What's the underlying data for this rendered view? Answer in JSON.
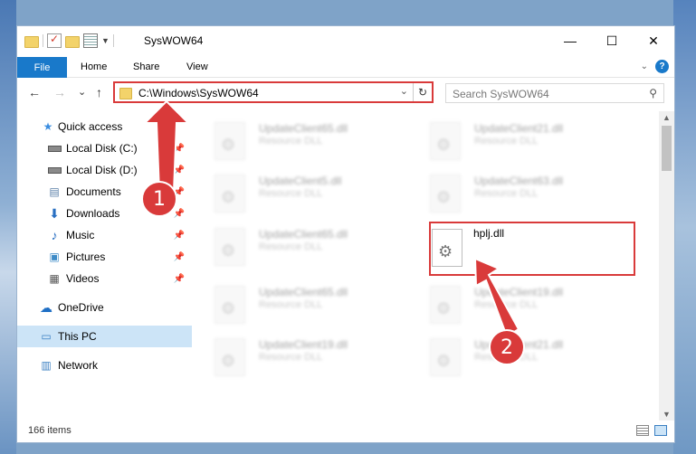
{
  "window": {
    "title": "SysWOW64",
    "minimize": "—",
    "maximize": "☐",
    "close": "✕"
  },
  "ribbon": {
    "tabs": [
      "File",
      "Home",
      "Share",
      "View"
    ]
  },
  "navigation": {
    "back": "←",
    "forward": "→",
    "recent": "⌄",
    "up": "↑"
  },
  "address_bar": {
    "path": "C:\\Windows\\SysWOW64"
  },
  "search": {
    "placeholder": "Search SysWOW64"
  },
  "sidebar": {
    "items": [
      {
        "label": "Quick access",
        "icon": "star-icon"
      },
      {
        "label": "Local Disk (C:)",
        "icon": "drive-icon",
        "pinned": true
      },
      {
        "label": "Local Disk (D:)",
        "icon": "drive-icon",
        "pinned": true
      },
      {
        "label": "Documents",
        "icon": "documents-icon",
        "pinned": true
      },
      {
        "label": "Downloads",
        "icon": "downloads-icon",
        "pinned": true
      },
      {
        "label": "Music",
        "icon": "music-icon",
        "pinned": true
      },
      {
        "label": "Pictures",
        "icon": "pictures-icon",
        "pinned": true
      },
      {
        "label": "Videos",
        "icon": "videos-icon",
        "pinned": true
      },
      {
        "label": "OneDrive",
        "icon": "cloud-icon"
      },
      {
        "label": "This PC",
        "icon": "computer-icon",
        "selected": true
      },
      {
        "label": "Network",
        "icon": "network-icon"
      }
    ]
  },
  "files": [
    {
      "name": "UpdateClient65.dll",
      "type": "Resource DLL",
      "blurred": true
    },
    {
      "name": "UpdateClient21.dll",
      "type": "Resource DLL",
      "blurred": true
    },
    {
      "name": "UpdateClient5.dll",
      "type": "Resource DLL",
      "blurred": true
    },
    {
      "name": "UpdateClient63.dll",
      "type": "Resource DLL",
      "blurred": true
    },
    {
      "name": "UpdateClient65.dll",
      "type": "Resource DLL",
      "blurred": true
    },
    {
      "name": "hplj.dll",
      "type": "",
      "blurred": false
    },
    {
      "name": "UpdateClient65.dll",
      "type": "Resource DLL",
      "blurred": true
    },
    {
      "name": "UpdateClient19.dll",
      "type": "Resource DLL",
      "blurred": true
    },
    {
      "name": "UpdateClient19.dll",
      "type": "Resource DLL",
      "blurred": true
    },
    {
      "name": "UpdateClient21.dll",
      "type": "Resource DLL",
      "blurred": true
    }
  ],
  "status": {
    "item_count": "166 items"
  },
  "annotations": {
    "step1": "1",
    "step2": "2",
    "color": "#d93a3a"
  }
}
